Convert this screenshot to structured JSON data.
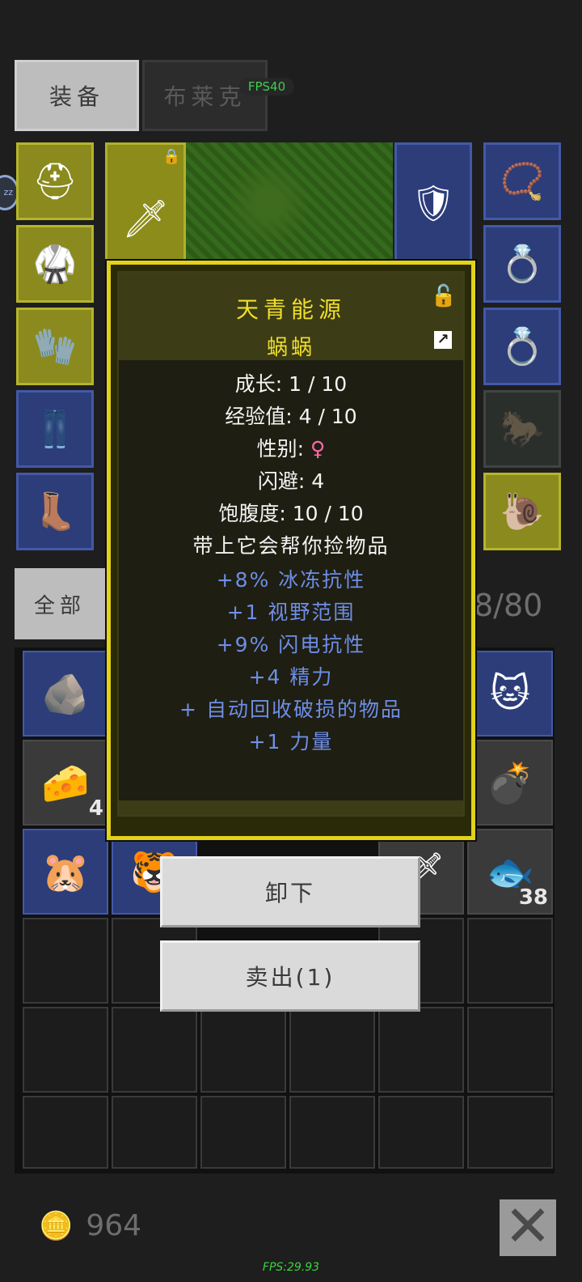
{
  "tabs": {
    "equipment_label": "装备",
    "blake_label": "布莱克"
  },
  "fps_top": "FPS40",
  "badge_zz": "zz",
  "equipment": {
    "slots_left": [
      "helmet-icon",
      "armor-icon",
      "gloves-icon",
      "pants-icon",
      "boots-icon"
    ],
    "weapon": "sword-icon",
    "shield": "shield-icon",
    "slots_right": [
      "amulet-icon",
      "ring-icon",
      "ring-icon",
      "pet-slot-icon",
      "pet-card-icon"
    ]
  },
  "inventory": {
    "category_label": "全部",
    "capacity": "8/80",
    "items": [
      {
        "icon": "stone-icon",
        "qty": ""
      },
      {
        "icon": "cheese-icon",
        "qty": "4"
      },
      {
        "icon": "pet-card-icon",
        "qty": ""
      },
      {
        "icon": "pet-card-icon",
        "qty": ""
      },
      {
        "icon": "pet-card-icon",
        "qty": ""
      },
      {
        "icon": "bomb-icon",
        "qty": ""
      },
      {
        "icon": "fish-icon",
        "qty": "38"
      }
    ]
  },
  "popup": {
    "title": "天青能源",
    "subtitle": "蜗蜗",
    "stats": [
      {
        "label": "成长",
        "value": "1 / 10"
      },
      {
        "label": "经验值",
        "value": "4 / 10"
      },
      {
        "label": "性别",
        "value": "♀"
      },
      {
        "label": "闪避",
        "value": "4"
      },
      {
        "label": "饱腹度",
        "value": "10 / 10"
      }
    ],
    "description": "带上它会帮你捡物品",
    "bonuses": [
      "+8% 冰冻抗性",
      "+1 视野范围",
      "+9% 闪电抗性",
      "+4 精力",
      "+ 自动回收破损的物品",
      "+1 力量"
    ]
  },
  "buttons": {
    "unequip": "卸下",
    "sell": "卖出(1)"
  },
  "gold": "964",
  "fps_bottom": "FPS:29.93",
  "colors": {
    "popup_border": "#e2d21a",
    "title": "#f0df2a",
    "bonus_text": "#6f8ee6",
    "gender": "#ff6aa8"
  }
}
